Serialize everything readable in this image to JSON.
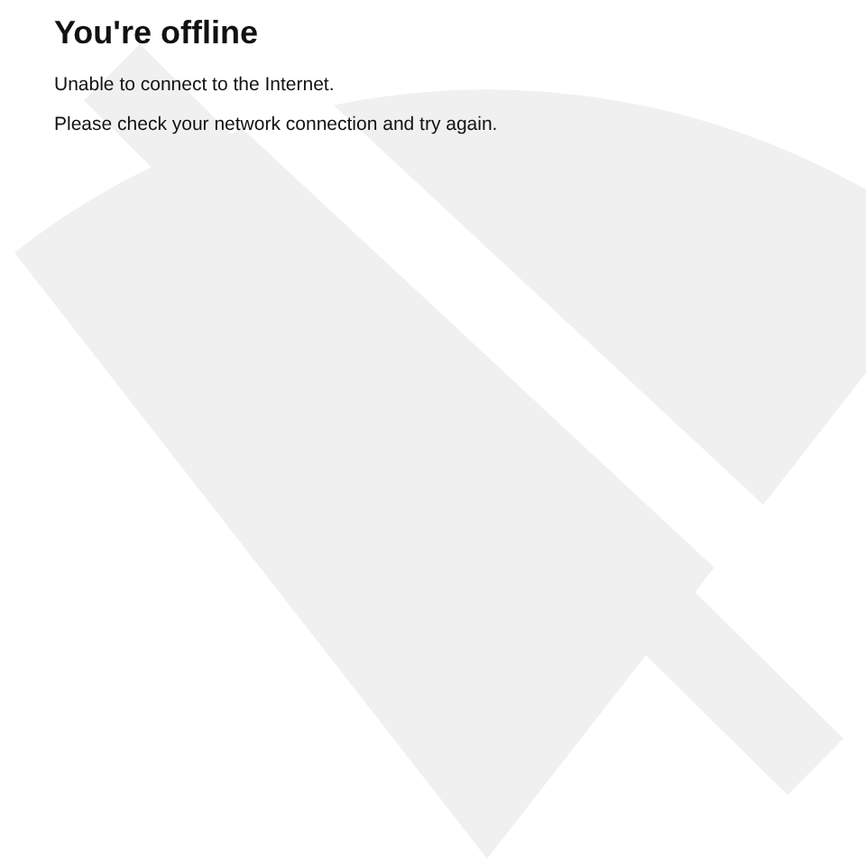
{
  "title": "You're offline",
  "messages": [
    "Unable to connect to the Internet.",
    "Please check your network connection and try again."
  ]
}
